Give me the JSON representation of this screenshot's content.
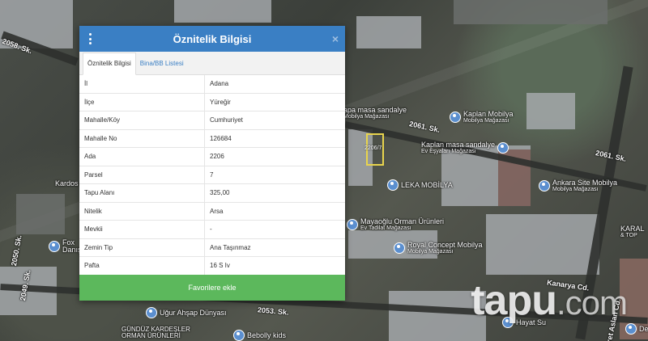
{
  "map": {
    "streets": [
      "2058. Sk.",
      "2061. Sk.",
      "2061. Sk.",
      "2049. Sk.",
      "2050. Sk.",
      "2053. Sk.",
      "Kanarya Cd.",
      "Fikret Aslan Cd."
    ],
    "pois": [
      {
        "name": "Kaplan Mobilya",
        "sub": "Mobilya Mağazası"
      },
      {
        "name": "Kaplan masa sandalye",
        "sub": "Ev Eşyaları Mağazası"
      },
      {
        "name": "apa masa sandalye",
        "sub": "Mobilya Mağazası"
      },
      {
        "name": "LEKA MOBİLYA",
        "sub": ""
      },
      {
        "name": "Ankara Site Mobilya",
        "sub": "Mobilya Mağazası"
      },
      {
        "name": "Mayaoğlu Orman Ürünleri",
        "sub": "Ev Tadilat Mağazası"
      },
      {
        "name": "Royal Concept Mobilya",
        "sub": "Mobilya Mağazası"
      },
      {
        "name": "Hayat Su",
        "sub": ""
      },
      {
        "name": "Uğur Ahşap Dünyası",
        "sub": ""
      },
      {
        "name": "Bebolly kids",
        "sub": ""
      },
      {
        "name": "GÜNDÜZ KARDEŞLER ORMAN ÜRÜNLERİ",
        "sub": ""
      },
      {
        "name": "Kardos",
        "sub": ""
      },
      {
        "name": "Fox Danış",
        "sub": ""
      },
      {
        "name": "KARAL",
        "sub": "& TOP"
      },
      {
        "name": "Defne",
        "sub": ""
      }
    ],
    "parcel_label": "2206/7",
    "watermark_main": "tapu",
    "watermark_suffix": ".com"
  },
  "panel": {
    "title": "Öznitelik Bilgisi",
    "close_glyph": "×",
    "tabs": [
      {
        "label": "Öznitelik Bilgisi",
        "active": true
      },
      {
        "label": "Bina/BB Listesi",
        "active": false
      }
    ],
    "rows": [
      {
        "key": "İl",
        "value": "Adana"
      },
      {
        "key": "İlçe",
        "value": "Yüreğir"
      },
      {
        "key": "Mahalle/Köy",
        "value": "Cumhuriyet"
      },
      {
        "key": "Mahalle No",
        "value": "126684"
      },
      {
        "key": "Ada",
        "value": "2206"
      },
      {
        "key": "Parsel",
        "value": "7"
      },
      {
        "key": "Tapu Alanı",
        "value": "325,00"
      },
      {
        "key": "Nitelik",
        "value": "Arsa"
      },
      {
        "key": "Mevkii",
        "value": "-"
      },
      {
        "key": "Zemin Tip",
        "value": "Ana Taşınmaz"
      },
      {
        "key": "Pafta",
        "value": "16 S Iv"
      }
    ],
    "favorite_button": "Favorilere ekle"
  },
  "colors": {
    "header": "#3a7fc4",
    "button": "#5cb85c",
    "parcel": "#e8d44d"
  }
}
